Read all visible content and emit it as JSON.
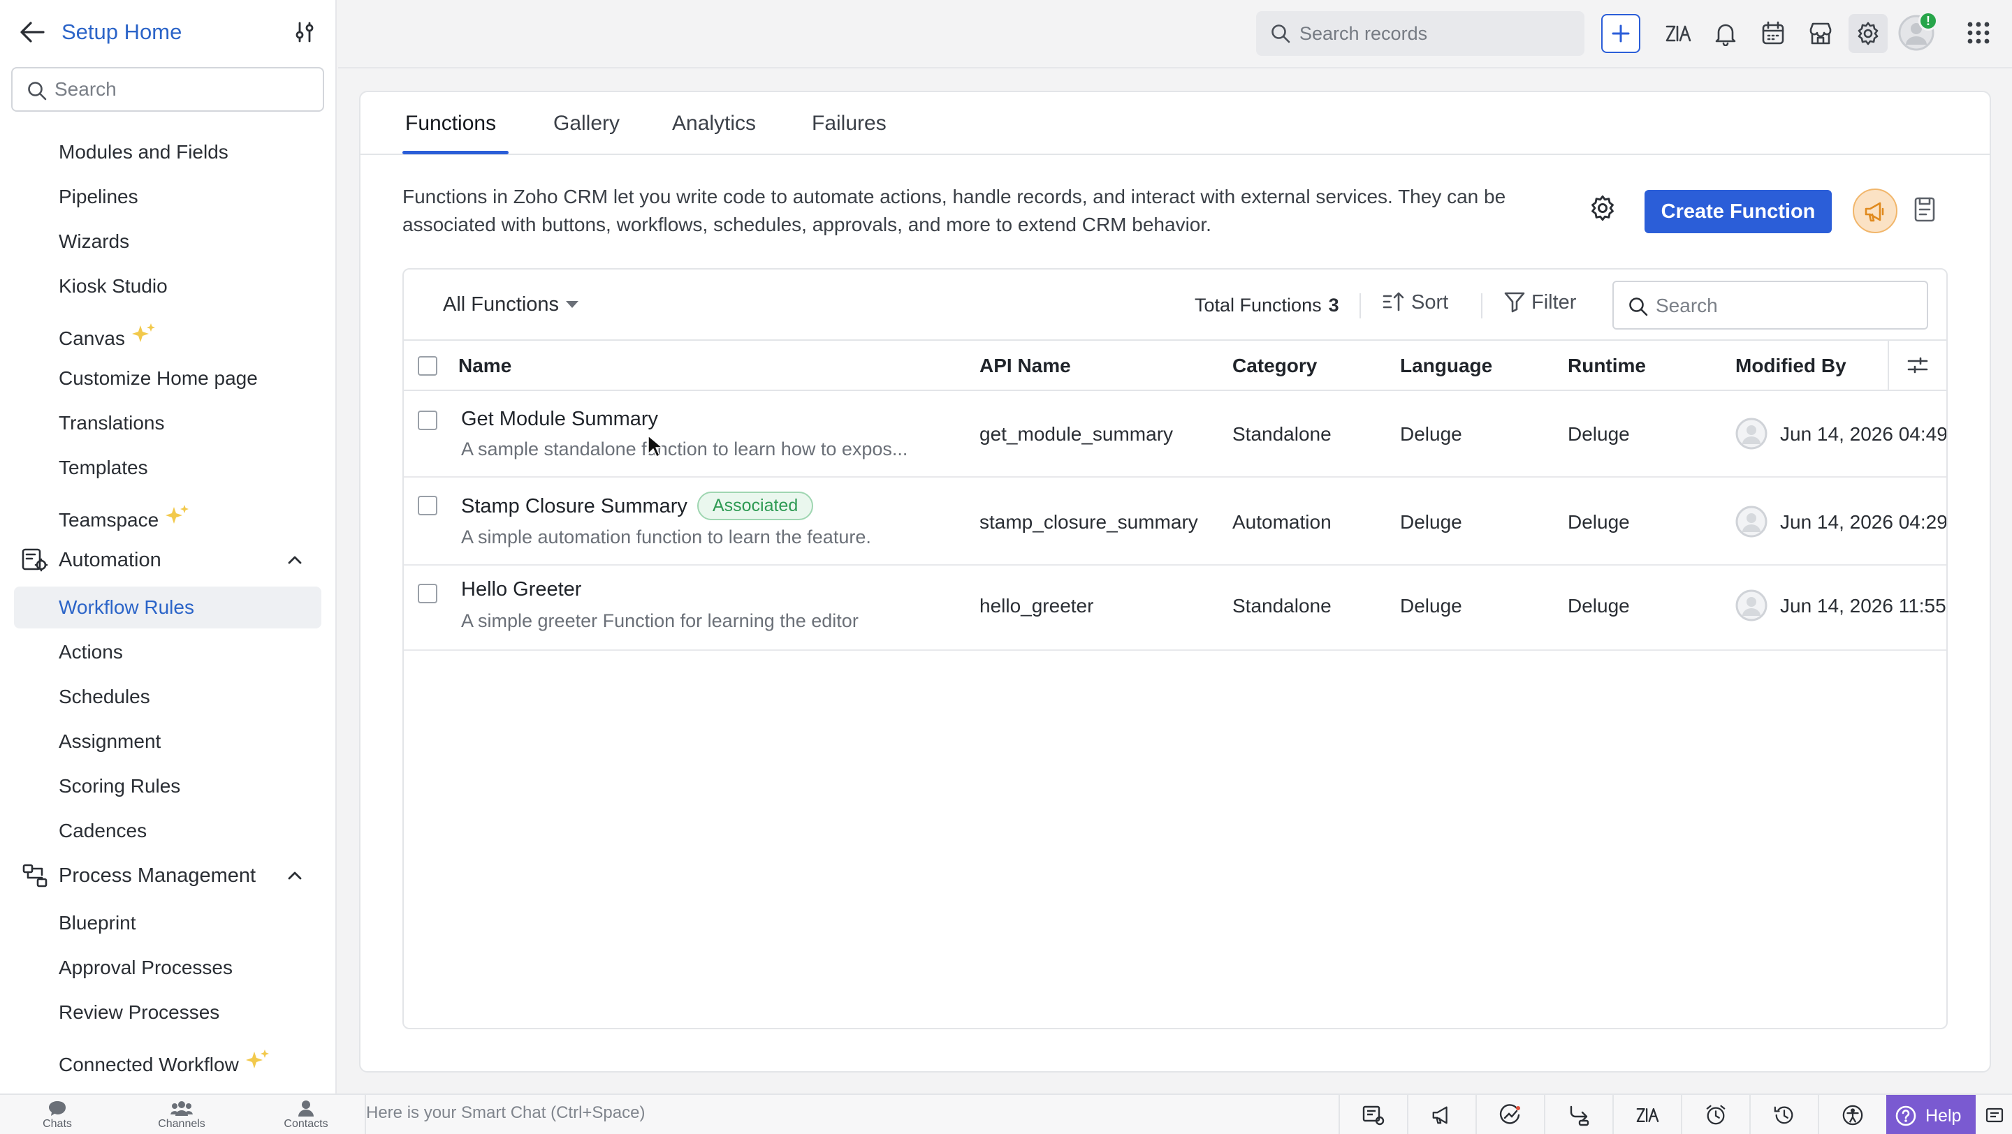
{
  "sidebar": {
    "title": "Setup Home",
    "search_placeholder": "Search",
    "items": [
      {
        "label": "Modules and Fields"
      },
      {
        "label": "Pipelines"
      },
      {
        "label": "Wizards"
      },
      {
        "label": "Kiosk Studio"
      },
      {
        "label": "Canvas"
      },
      {
        "label": "Customize Home page"
      },
      {
        "label": "Translations"
      },
      {
        "label": "Templates"
      },
      {
        "label": "Teamspace"
      }
    ],
    "automation": {
      "label": "Automation",
      "items": [
        {
          "label": "Workflow Rules"
        },
        {
          "label": "Actions"
        },
        {
          "label": "Schedules"
        },
        {
          "label": "Assignment"
        },
        {
          "label": "Scoring Rules"
        },
        {
          "label": "Cadences"
        }
      ]
    },
    "process": {
      "label": "Process Management",
      "items": [
        {
          "label": "Blueprint"
        },
        {
          "label": "Approval Processes"
        },
        {
          "label": "Review Processes"
        },
        {
          "label": "Connected Workflow"
        }
      ]
    }
  },
  "topbar": {
    "search_placeholder": "Search records",
    "notification_badge": "!"
  },
  "tabs": [
    {
      "label": "Functions"
    },
    {
      "label": "Gallery"
    },
    {
      "label": "Analytics"
    },
    {
      "label": "Failures"
    }
  ],
  "description": "Functions in Zoho CRM let you write code to automate actions, handle records, and interact with external services. They can be associated with buttons, workflows, schedules, approvals, and more to extend CRM behavior.",
  "create_button": "Create Function",
  "toolbar": {
    "view": "All Functions",
    "total_label": "Total Functions",
    "total_count": "3",
    "sort": "Sort",
    "filter": "Filter",
    "search_placeholder": "Search"
  },
  "columns": [
    "Name",
    "API Name",
    "Category",
    "Language",
    "Runtime",
    "Modified By"
  ],
  "rows": [
    {
      "name": "Get Module Summary",
      "desc": "A sample standalone function to learn how to expos...",
      "badge": "",
      "api": "get_module_summary",
      "category": "Standalone",
      "language": "Deluge",
      "runtime": "Deluge",
      "modified": "Jun 14, 2026 04:49"
    },
    {
      "name": "Stamp Closure Summary",
      "desc": "A simple automation function to learn the feature.",
      "badge": "Associated",
      "api": "stamp_closure_summary",
      "category": "Automation",
      "language": "Deluge",
      "runtime": "Deluge",
      "modified": "Jun 14, 2026 04:29"
    },
    {
      "name": "Hello Greeter",
      "desc": "A simple greeter Function for learning the editor",
      "badge": "",
      "api": "hello_greeter",
      "category": "Standalone",
      "language": "Deluge",
      "runtime": "Deluge",
      "modified": "Jun 14, 2026 11:55"
    }
  ],
  "bottombar": {
    "chats": "Chats",
    "channels": "Channels",
    "contacts": "Contacts",
    "smart_chat": "Here is your Smart Chat (Ctrl+Space)",
    "help": "Help"
  }
}
